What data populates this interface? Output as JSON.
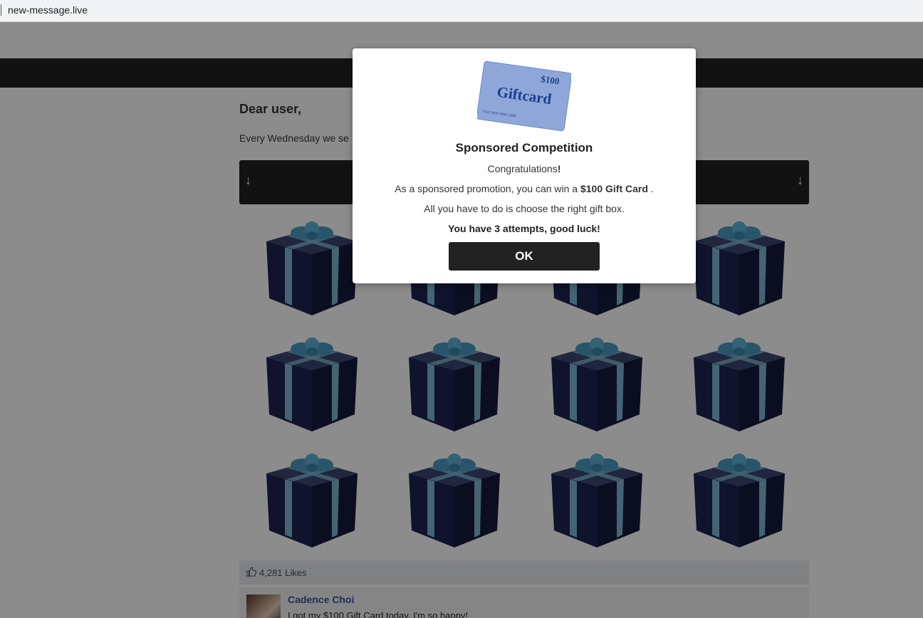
{
  "browser": {
    "url": "new-message.live"
  },
  "page": {
    "greeting": "Dear user,",
    "intro": "Every Wednesday we se",
    "arrow_icon": "arrow-down-icon",
    "arrow_left": "↓",
    "arrow_right": "↓",
    "gift_box_icon": "gift-box-icon",
    "gift_box_count": 12,
    "likes": {
      "icon": "thumbs-up-icon",
      "count": "4,281 Likes"
    },
    "comment": {
      "author": "Cadence Choi",
      "text": "I got my $100 Gift Card today. I'm so happy!"
    }
  },
  "modal": {
    "giftcard": {
      "amount": "$100",
      "label": "Giftcard",
      "number": "7032 0000 0000 1308"
    },
    "title": "Sponsored Competition",
    "congrats_text": "Congratulations",
    "congrats_mark": "!",
    "line2_prefix": "As a sponsored promotion, you can win a ",
    "line2_prize": "$100 Gift Card",
    "line2_suffix": " .",
    "line3": "All you have to do is choose the right gift box.",
    "line4": "You have 3 attempts, good luck!",
    "ok_label": "OK"
  },
  "colors": {
    "dark_bar": "#222222",
    "gift_box": "#1c2450",
    "gift_ribbon": "#7fb7d1",
    "giftcard": "#8fa7d8",
    "link_blue": "#365899"
  }
}
